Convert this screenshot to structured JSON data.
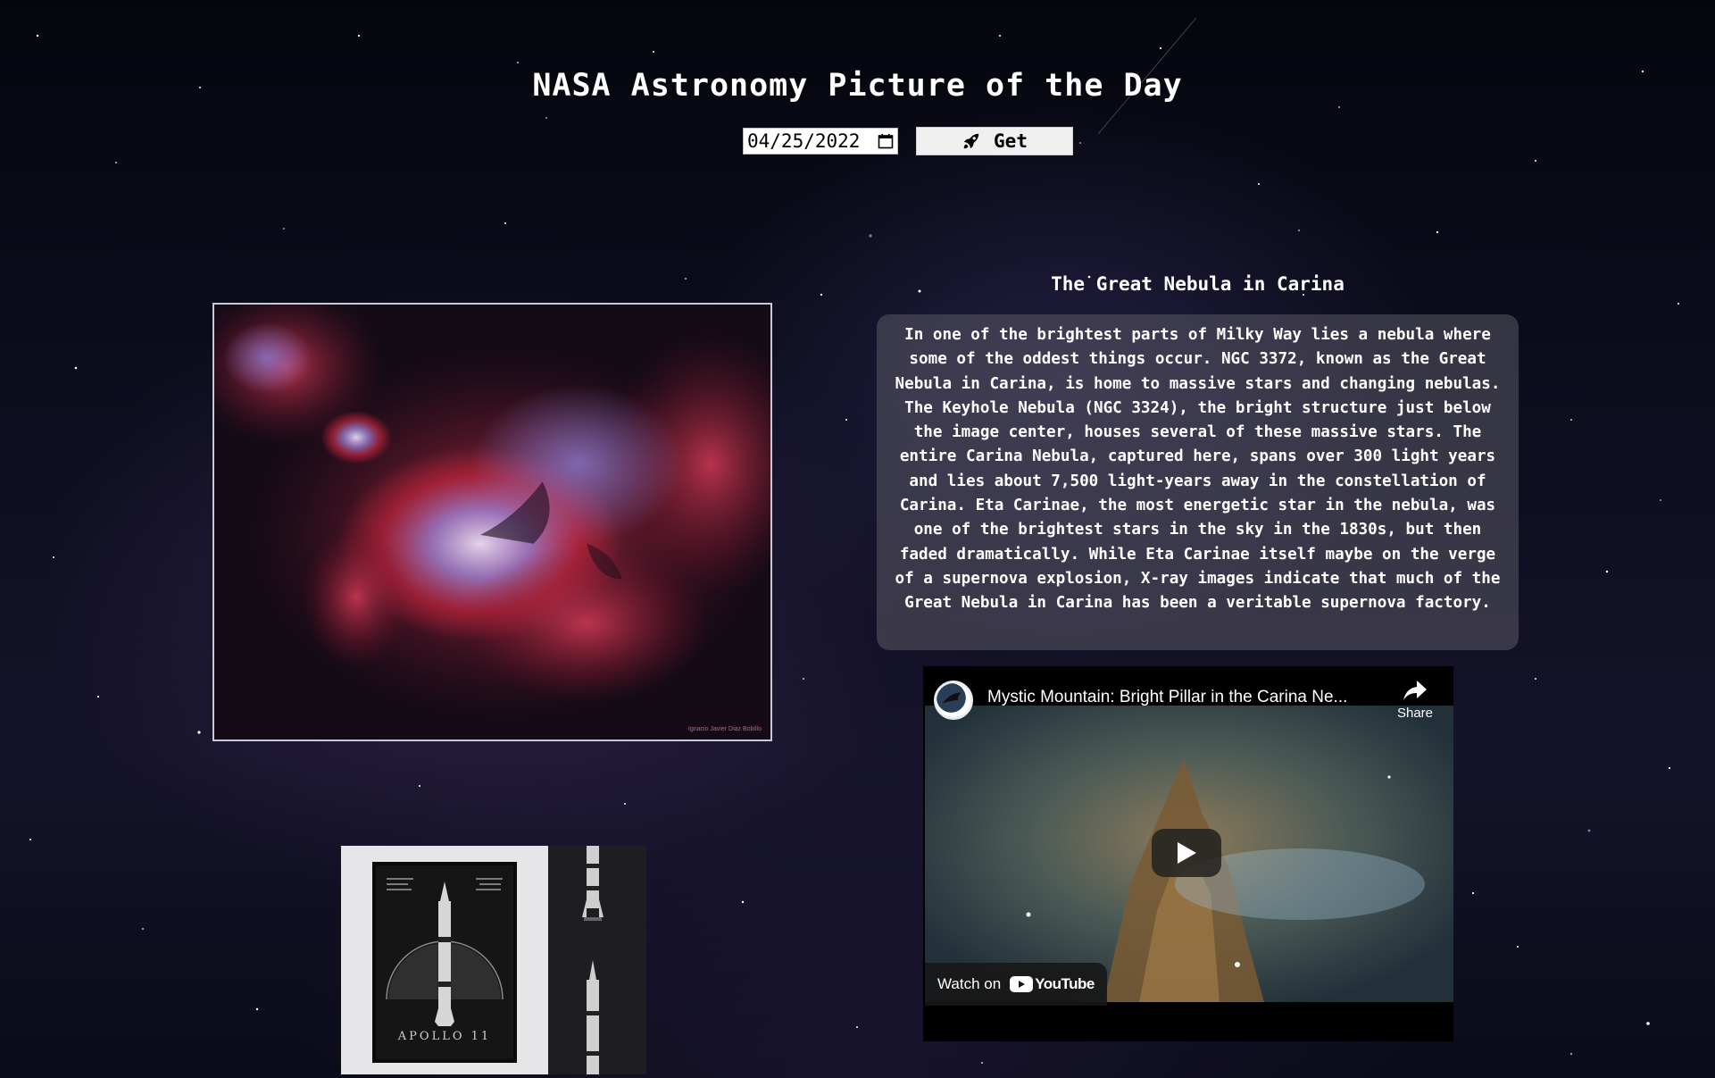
{
  "header": {
    "title": "NASA Astronomy Picture of the Day"
  },
  "controls": {
    "date_value": "04/25/2022",
    "get_label": "Get"
  },
  "apod": {
    "title": "The Great Nebula in Carina",
    "explanation": "In one of the brightest parts of Milky Way lies a nebula where some of the oddest things occur. NGC 3372, known as the Great Nebula in Carina, is home to massive stars and changing nebulas. The Keyhole Nebula (NGC 3324), the bright structure just below the image center, houses several of these massive stars. The entire Carina Nebula, captured here, spans over 300 light years and lies about 7,500 light-years away in the constellation of Carina. Eta Carinae, the most energetic star in the nebula, was one of the brightest stars in the sky in the 1830s, but then faded dramatically. While Eta Carinae itself maybe on the verge of a supernova explosion, X-ray images indicate that much of the Great Nebula in Carina has been a veritable supernova factory.",
    "image_credit": "Ignacio Javier Diaz Bobillo"
  },
  "video": {
    "title": "Mystic Mountain: Bright Pillar in the Carina Ne...",
    "share_label": "Share",
    "watch_on_label": "Watch on",
    "youtube_label": "YouTube"
  },
  "ad": {
    "poster_caption": "APOLLO 11"
  },
  "colors": {
    "nebula_red": "#c8243c",
    "nebula_violet": "#8a7ad0",
    "youtube_red": "#ff0000"
  }
}
